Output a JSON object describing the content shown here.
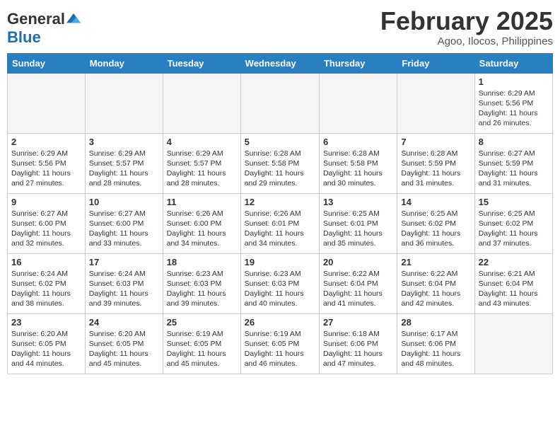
{
  "logo": {
    "general": "General",
    "blue": "Blue"
  },
  "title": "February 2025",
  "location": "Agoo, Ilocos, Philippines",
  "days_of_week": [
    "Sunday",
    "Monday",
    "Tuesday",
    "Wednesday",
    "Thursday",
    "Friday",
    "Saturday"
  ],
  "weeks": [
    {
      "days": [
        {
          "num": "",
          "info": ""
        },
        {
          "num": "",
          "info": ""
        },
        {
          "num": "",
          "info": ""
        },
        {
          "num": "",
          "info": ""
        },
        {
          "num": "",
          "info": ""
        },
        {
          "num": "",
          "info": ""
        },
        {
          "num": "1",
          "info": "Sunrise: 6:29 AM\nSunset: 5:56 PM\nDaylight: 11 hours and 26 minutes."
        }
      ]
    },
    {
      "days": [
        {
          "num": "2",
          "info": "Sunrise: 6:29 AM\nSunset: 5:56 PM\nDaylight: 11 hours and 27 minutes."
        },
        {
          "num": "3",
          "info": "Sunrise: 6:29 AM\nSunset: 5:57 PM\nDaylight: 11 hours and 28 minutes."
        },
        {
          "num": "4",
          "info": "Sunrise: 6:29 AM\nSunset: 5:57 PM\nDaylight: 11 hours and 28 minutes."
        },
        {
          "num": "5",
          "info": "Sunrise: 6:28 AM\nSunset: 5:58 PM\nDaylight: 11 hours and 29 minutes."
        },
        {
          "num": "6",
          "info": "Sunrise: 6:28 AM\nSunset: 5:58 PM\nDaylight: 11 hours and 30 minutes."
        },
        {
          "num": "7",
          "info": "Sunrise: 6:28 AM\nSunset: 5:59 PM\nDaylight: 11 hours and 31 minutes."
        },
        {
          "num": "8",
          "info": "Sunrise: 6:27 AM\nSunset: 5:59 PM\nDaylight: 11 hours and 31 minutes."
        }
      ]
    },
    {
      "days": [
        {
          "num": "9",
          "info": "Sunrise: 6:27 AM\nSunset: 6:00 PM\nDaylight: 11 hours and 32 minutes."
        },
        {
          "num": "10",
          "info": "Sunrise: 6:27 AM\nSunset: 6:00 PM\nDaylight: 11 hours and 33 minutes."
        },
        {
          "num": "11",
          "info": "Sunrise: 6:26 AM\nSunset: 6:00 PM\nDaylight: 11 hours and 34 minutes."
        },
        {
          "num": "12",
          "info": "Sunrise: 6:26 AM\nSunset: 6:01 PM\nDaylight: 11 hours and 34 minutes."
        },
        {
          "num": "13",
          "info": "Sunrise: 6:25 AM\nSunset: 6:01 PM\nDaylight: 11 hours and 35 minutes."
        },
        {
          "num": "14",
          "info": "Sunrise: 6:25 AM\nSunset: 6:02 PM\nDaylight: 11 hours and 36 minutes."
        },
        {
          "num": "15",
          "info": "Sunrise: 6:25 AM\nSunset: 6:02 PM\nDaylight: 11 hours and 37 minutes."
        }
      ]
    },
    {
      "days": [
        {
          "num": "16",
          "info": "Sunrise: 6:24 AM\nSunset: 6:02 PM\nDaylight: 11 hours and 38 minutes."
        },
        {
          "num": "17",
          "info": "Sunrise: 6:24 AM\nSunset: 6:03 PM\nDaylight: 11 hours and 39 minutes."
        },
        {
          "num": "18",
          "info": "Sunrise: 6:23 AM\nSunset: 6:03 PM\nDaylight: 11 hours and 39 minutes."
        },
        {
          "num": "19",
          "info": "Sunrise: 6:23 AM\nSunset: 6:03 PM\nDaylight: 11 hours and 40 minutes."
        },
        {
          "num": "20",
          "info": "Sunrise: 6:22 AM\nSunset: 6:04 PM\nDaylight: 11 hours and 41 minutes."
        },
        {
          "num": "21",
          "info": "Sunrise: 6:22 AM\nSunset: 6:04 PM\nDaylight: 11 hours and 42 minutes."
        },
        {
          "num": "22",
          "info": "Sunrise: 6:21 AM\nSunset: 6:04 PM\nDaylight: 11 hours and 43 minutes."
        }
      ]
    },
    {
      "days": [
        {
          "num": "23",
          "info": "Sunrise: 6:20 AM\nSunset: 6:05 PM\nDaylight: 11 hours and 44 minutes."
        },
        {
          "num": "24",
          "info": "Sunrise: 6:20 AM\nSunset: 6:05 PM\nDaylight: 11 hours and 45 minutes."
        },
        {
          "num": "25",
          "info": "Sunrise: 6:19 AM\nSunset: 6:05 PM\nDaylight: 11 hours and 45 minutes."
        },
        {
          "num": "26",
          "info": "Sunrise: 6:19 AM\nSunset: 6:05 PM\nDaylight: 11 hours and 46 minutes."
        },
        {
          "num": "27",
          "info": "Sunrise: 6:18 AM\nSunset: 6:06 PM\nDaylight: 11 hours and 47 minutes."
        },
        {
          "num": "28",
          "info": "Sunrise: 6:17 AM\nSunset: 6:06 PM\nDaylight: 11 hours and 48 minutes."
        },
        {
          "num": "",
          "info": ""
        }
      ]
    }
  ]
}
